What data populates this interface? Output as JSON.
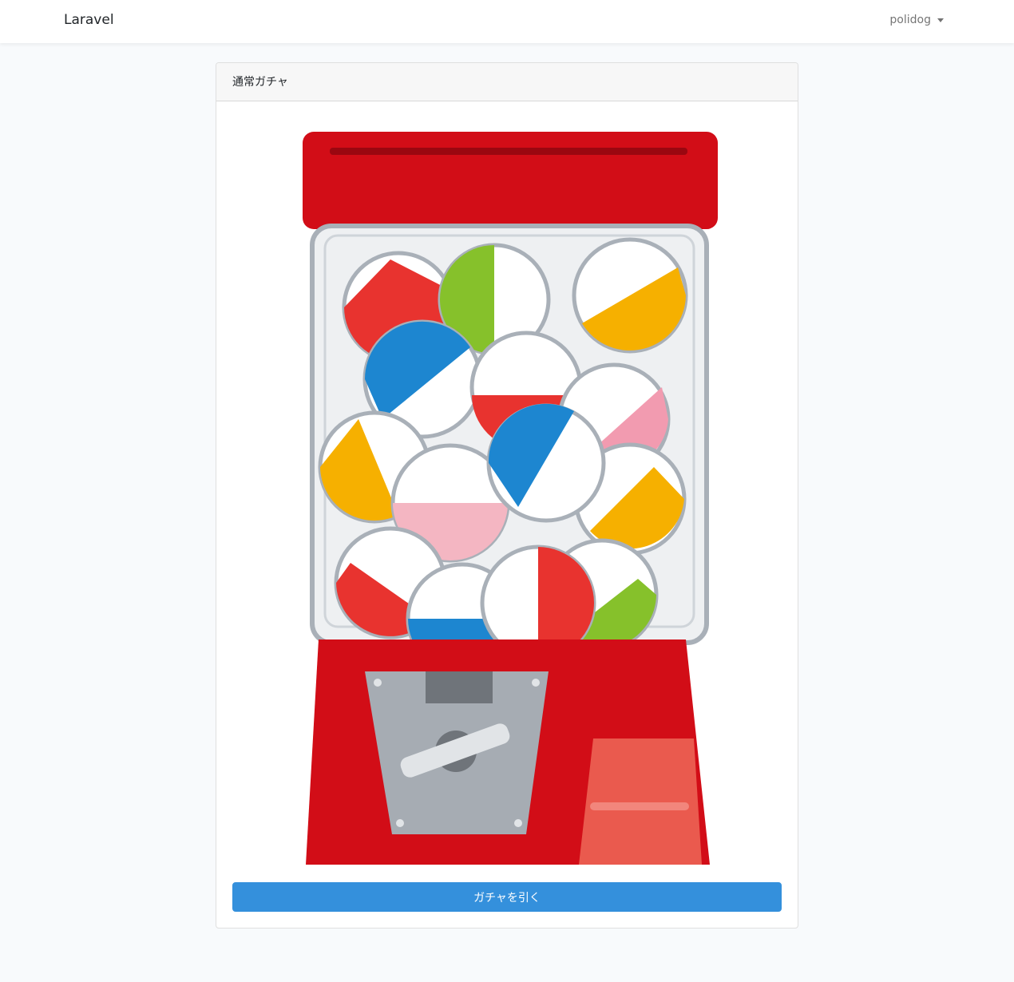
{
  "navbar": {
    "brand": "Laravel",
    "user_name": "polidog"
  },
  "card": {
    "title": "通常ガチャ",
    "button_label": "ガチャを引く"
  },
  "colors": {
    "primary": "#3490dc",
    "machine_red": "#d20d17",
    "glass": "#eef0f2"
  },
  "illustration": {
    "subject": "gashapon-capsule-machine-icon"
  }
}
